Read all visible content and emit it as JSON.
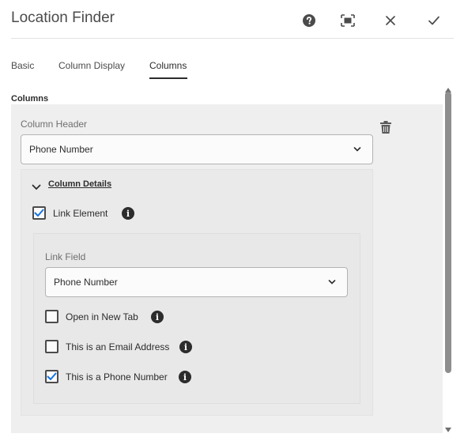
{
  "header": {
    "title": "Location Finder",
    "icons": [
      "help-icon",
      "fullscreen-icon",
      "close-icon",
      "done-icon"
    ]
  },
  "tabs": [
    {
      "label": "Basic",
      "active": false
    },
    {
      "label": "Column Display",
      "active": false
    },
    {
      "label": "Columns",
      "active": true
    }
  ],
  "section": {
    "label": "Columns"
  },
  "column_item": {
    "header_label": "Column Header",
    "header_value": "Phone Number",
    "details_title": "Column Details",
    "link_element": {
      "label": "Link Element",
      "checked": true
    },
    "link_field": {
      "label": "Link Field",
      "value": "Phone Number"
    },
    "options": [
      {
        "label": "Open in New Tab",
        "checked": false
      },
      {
        "label": "This is an Email Address",
        "checked": false
      },
      {
        "label": "This is a Phone Number",
        "checked": true
      }
    ]
  },
  "colors": {
    "accent": "#1473e6",
    "text": "#2c2c2c",
    "panel": "#efefef"
  }
}
